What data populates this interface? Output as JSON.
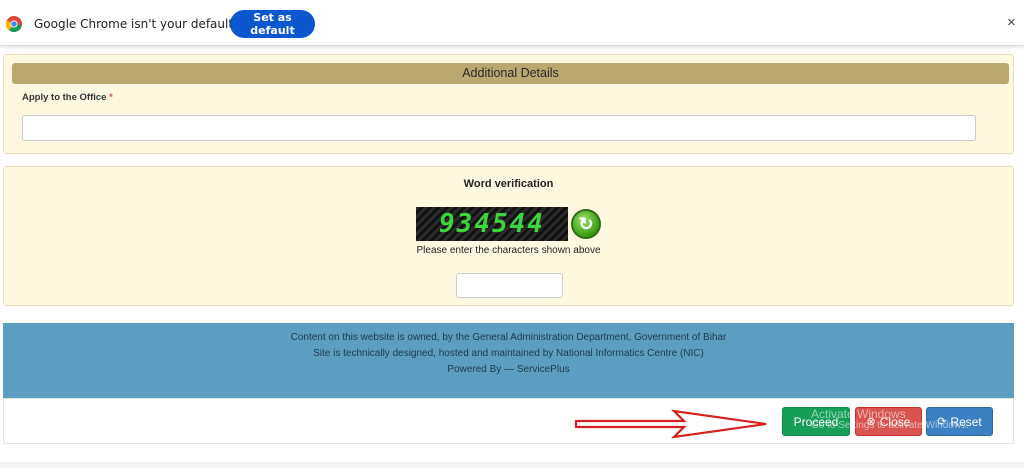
{
  "infobar": {
    "message": "Google Chrome isn't your default browser",
    "set_default_label": "Set as default",
    "close_glyph": "×"
  },
  "details": {
    "header": "Additional Details",
    "office_label": "Apply to the Office",
    "required_mark": "*",
    "office_value": ""
  },
  "verification": {
    "title": "Word verification",
    "captcha_text": "934544",
    "refresh_glyph": "↻",
    "hint": "Please enter the characters shown above",
    "input_value": ""
  },
  "footer": {
    "line1": "Content on this website is owned, by the General Administration Department, Government of Bihar",
    "line2": "Site is technically designed, hosted and maintained by National Informatics Centre (NIC)",
    "line3": "Powered By — ServicePlus"
  },
  "actions": {
    "proceed_label": "Proceed",
    "close_label": "Close",
    "reset_label": "Reset",
    "close_icon": "⊗",
    "reset_icon": "⟳"
  },
  "watermark": {
    "line1": "Activate Windows",
    "line2": "Go to Settings to activate Windows."
  },
  "colors": {
    "proceed": "#149e58",
    "close": "#d9534f",
    "reset": "#3b80c2",
    "footer": "#5b9ec2",
    "panel_bg": "#fff8e1",
    "header_bg": "#b9a86f",
    "arrow": "#d62020"
  }
}
